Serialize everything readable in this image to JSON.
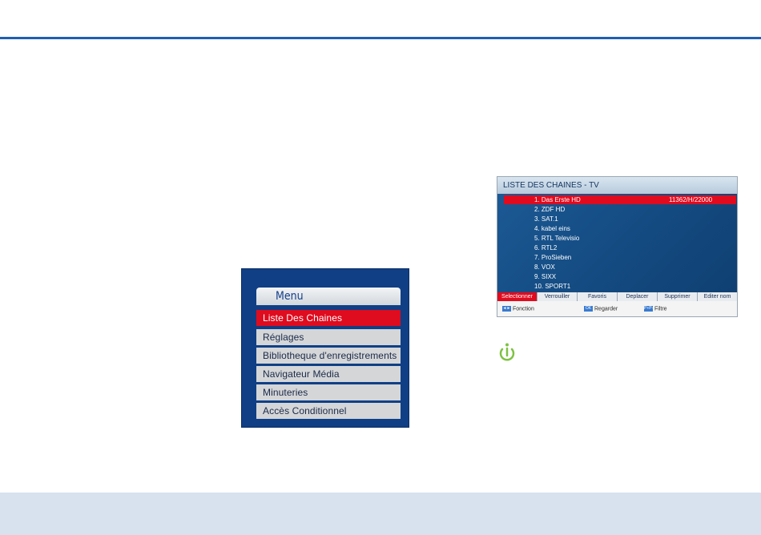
{
  "colors": {
    "accent_blue": "#1f5fb0",
    "footer_band": "#d7e2ee",
    "selection_red": "#e00b1f",
    "info_green": "#7ec242"
  },
  "menu": {
    "title": "Menu",
    "items": [
      {
        "label": "Liste Des Chaines",
        "selected": true
      },
      {
        "label": "Réglages",
        "selected": false
      },
      {
        "label": "Bibliotheque d'enregistrements",
        "selected": false
      },
      {
        "label": "Navigateur Média",
        "selected": false
      },
      {
        "label": "Minuteries",
        "selected": false
      },
      {
        "label": "Accès Conditionnel",
        "selected": false
      }
    ]
  },
  "channel_list": {
    "title": "LISTE DES CHAINES - TV",
    "channels": [
      {
        "label": "1. Das Erste HD",
        "freq": "11362/H/22000",
        "selected": true
      },
      {
        "label": "2. ZDF HD",
        "freq": "",
        "selected": false
      },
      {
        "label": "3. SAT.1",
        "freq": "",
        "selected": false
      },
      {
        "label": "4. kabel eins",
        "freq": "",
        "selected": false
      },
      {
        "label": "5. RTL Televisio",
        "freq": "",
        "selected": false
      },
      {
        "label": "6. RTL2",
        "freq": "",
        "selected": false
      },
      {
        "label": "7. ProSieben",
        "freq": "",
        "selected": false
      },
      {
        "label": "8. VOX",
        "freq": "",
        "selected": false
      },
      {
        "label": "9. SIXX",
        "freq": "",
        "selected": false
      },
      {
        "label": "10. SPORT1",
        "freq": "",
        "selected": false
      }
    ],
    "buttons": [
      {
        "label": "Selectionner",
        "selected": true
      },
      {
        "label": "Verrouiller",
        "selected": false
      },
      {
        "label": "Favoris",
        "selected": false
      },
      {
        "label": "Deplacer",
        "selected": false
      },
      {
        "label": "Supprimer",
        "selected": false
      },
      {
        "label": "Editer nom",
        "selected": false
      }
    ],
    "legend": [
      {
        "key": "◄►",
        "label": "Fonction"
      },
      {
        "key": "OK",
        "label": "Regarder"
      },
      {
        "key": "P+P-",
        "label": "Filtre"
      }
    ]
  },
  "icons": {
    "info": "info-icon"
  }
}
